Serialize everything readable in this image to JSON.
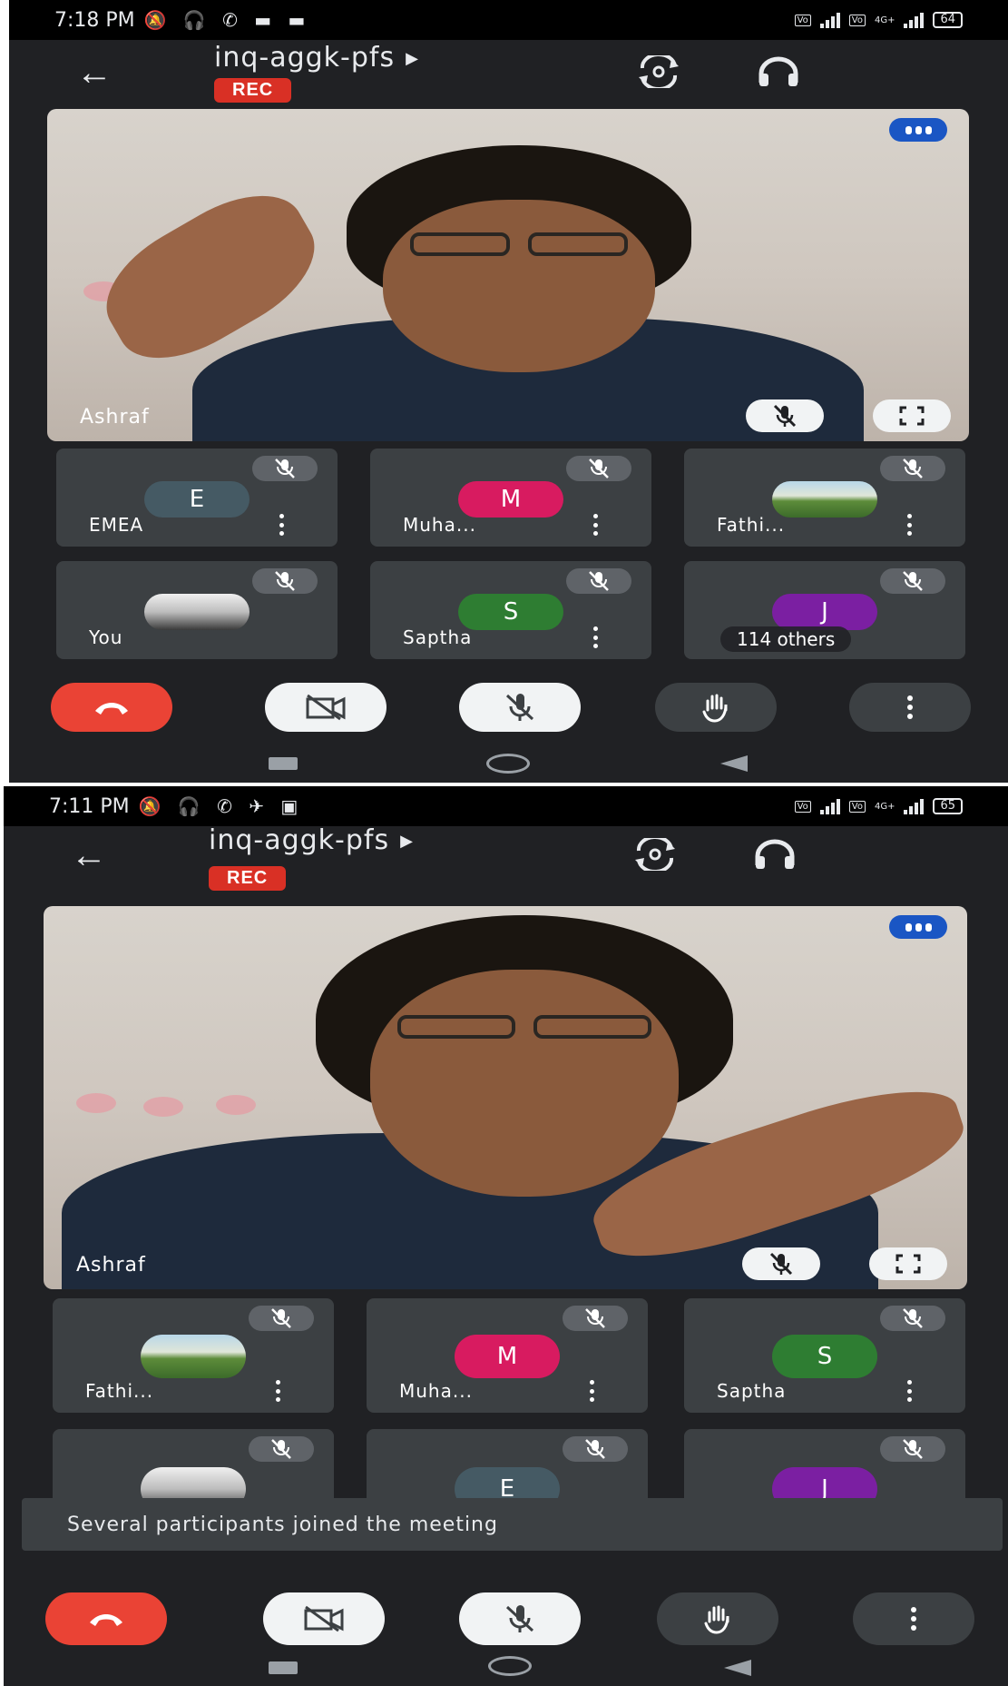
{
  "screens": [
    {
      "status": {
        "time": "7:18 PM",
        "battery": "64",
        "network": "4G+"
      },
      "meeting": {
        "code": "inq-aggk-pfs",
        "rec_label": "REC"
      },
      "main_video": {
        "name": "Ashraf"
      },
      "tiles": [
        {
          "name": "EMEA",
          "initial": "E",
          "color": "#455a64",
          "type": "letter",
          "menu": true
        },
        {
          "name": "Muha...",
          "initial": "M",
          "color": "#d81b60",
          "type": "letter",
          "menu": true
        },
        {
          "name": "Fathi...",
          "initial": "",
          "color": "",
          "type": "photo-green",
          "menu": true
        },
        {
          "name": "You",
          "initial": "",
          "color": "",
          "type": "photo-gray",
          "menu": false
        },
        {
          "name": "Saptha",
          "initial": "S",
          "color": "#2e7d32",
          "type": "letter",
          "menu": true
        },
        {
          "name": "",
          "initial": "J",
          "color": "#7b1fa2",
          "type": "letter",
          "menu": false,
          "overlay": "114 others"
        }
      ]
    },
    {
      "status": {
        "time": "7:11 PM",
        "battery": "65",
        "network": "4G+"
      },
      "meeting": {
        "code": "inq-aggk-pfs",
        "rec_label": "REC"
      },
      "main_video": {
        "name": "Ashraf"
      },
      "tiles": [
        {
          "name": "Fathi...",
          "initial": "",
          "color": "",
          "type": "photo-green",
          "menu": true
        },
        {
          "name": "Muha...",
          "initial": "M",
          "color": "#d81b60",
          "type": "letter",
          "menu": true
        },
        {
          "name": "Saptha",
          "initial": "S",
          "color": "#2e7d32",
          "type": "letter",
          "menu": true
        },
        {
          "name": "",
          "initial": "",
          "color": "",
          "type": "photo-gray",
          "menu": false
        },
        {
          "name": "",
          "initial": "E",
          "color": "#455a64",
          "type": "letter",
          "menu": false
        },
        {
          "name": "",
          "initial": "J",
          "color": "#7b1fa2",
          "type": "letter",
          "menu": false
        }
      ],
      "toast": "Several participants joined the meeting"
    }
  ],
  "colors": {
    "background": "#202124",
    "tile": "#3c4043",
    "end_call": "#ea4335",
    "rec": "#d93025",
    "accent_blue": "#1a56c4"
  },
  "icons": [
    "back-arrow-icon",
    "switch-camera-icon",
    "headphones-icon",
    "more-options-icon",
    "mic-off-icon",
    "fullscreen-icon",
    "end-call-icon",
    "camera-off-icon",
    "raise-hand-icon",
    "overflow-menu-icon"
  ]
}
